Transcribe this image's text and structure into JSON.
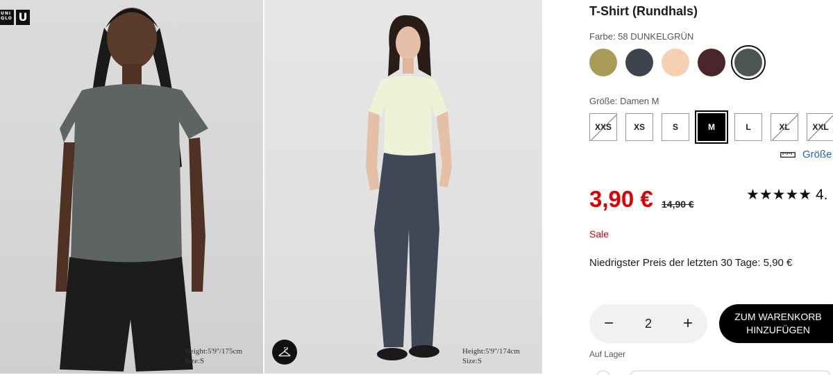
{
  "brand": {
    "logo_text_small": "UNI QLO",
    "logo_text_big": "U"
  },
  "gallery": {
    "photos": [
      {
        "caption_height": "Height:5'9''/175cm",
        "caption_size": "Size:S"
      },
      {
        "caption_height": "Height:5'9''/174cm",
        "caption_size": "Size:S"
      }
    ],
    "hanger_icon": "hanger-icon"
  },
  "product": {
    "title": "T-Shirt (Rundhals)",
    "color_label": "Farbe: 58 DUNKELGRÜN",
    "colors": [
      {
        "hex": "#a79b57",
        "selected": false
      },
      {
        "hex": "#3d444e",
        "selected": false
      },
      {
        "hex": "#f6d0b0",
        "selected": false
      },
      {
        "hex": "#4a262c",
        "selected": false
      },
      {
        "hex": "#4c5554",
        "selected": true
      }
    ],
    "size_label": "Größe: Damen M",
    "sizes": [
      {
        "label": "XXS",
        "available": false,
        "selected": false
      },
      {
        "label": "XS",
        "available": true,
        "selected": false
      },
      {
        "label": "S",
        "available": true,
        "selected": false
      },
      {
        "label": "M",
        "available": true,
        "selected": true
      },
      {
        "label": "L",
        "available": true,
        "selected": false
      },
      {
        "label": "XL",
        "available": false,
        "selected": false
      },
      {
        "label": "XXL",
        "available": false,
        "selected": false
      }
    ],
    "size_guide_label": "Größe",
    "price": "3,90 €",
    "old_price": "14,90 €",
    "rating_stars": "★★★★★",
    "rating_value": "4.",
    "sale_label": "Sale",
    "lowest_price_text": "Niedrigster Preis der letzten 30 Tage: 5,90 €",
    "quantity": "2",
    "qty_minus": "−",
    "qty_plus": "+",
    "add_to_cart_label": "ZUM WARENKORB\nHINZUFÜGEN",
    "stock_label": "Auf Lager"
  },
  "colors": {
    "sale_red": "#e00000",
    "link_blue": "#1a66c9",
    "black": "#000000"
  }
}
